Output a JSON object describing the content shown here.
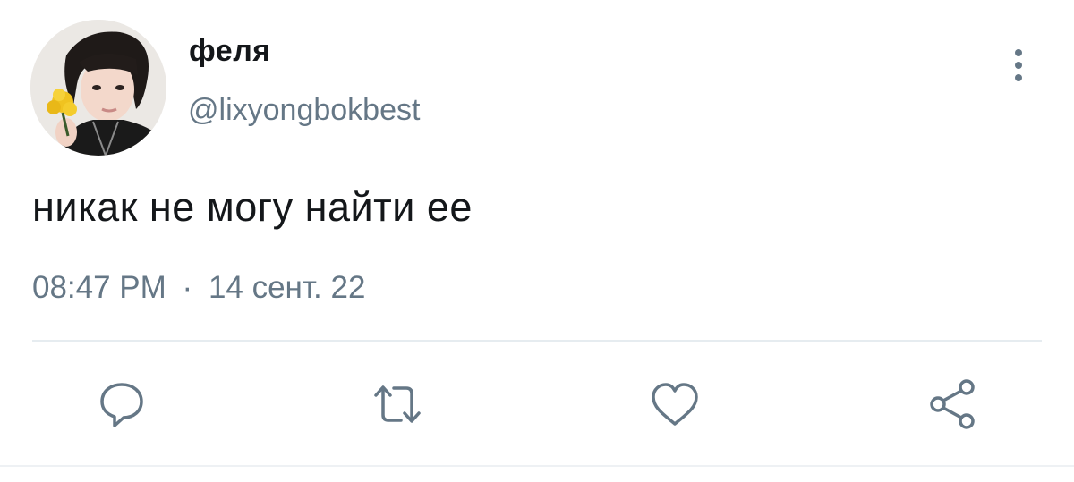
{
  "tweet": {
    "display_name": "феля",
    "handle": "@lixyongbokbest",
    "text": "никак не могу найти ее",
    "time": "08:47 PM",
    "separator": "·",
    "date": "14 сент. 22"
  },
  "icons": {
    "more": "more-vertical-icon",
    "reply": "reply-icon",
    "retweet": "retweet-icon",
    "like": "heart-icon",
    "share": "share-icon"
  },
  "colors": {
    "text": "#14171a",
    "secondary": "#657786",
    "divider": "#e6ecf0",
    "icon": "#657786"
  }
}
